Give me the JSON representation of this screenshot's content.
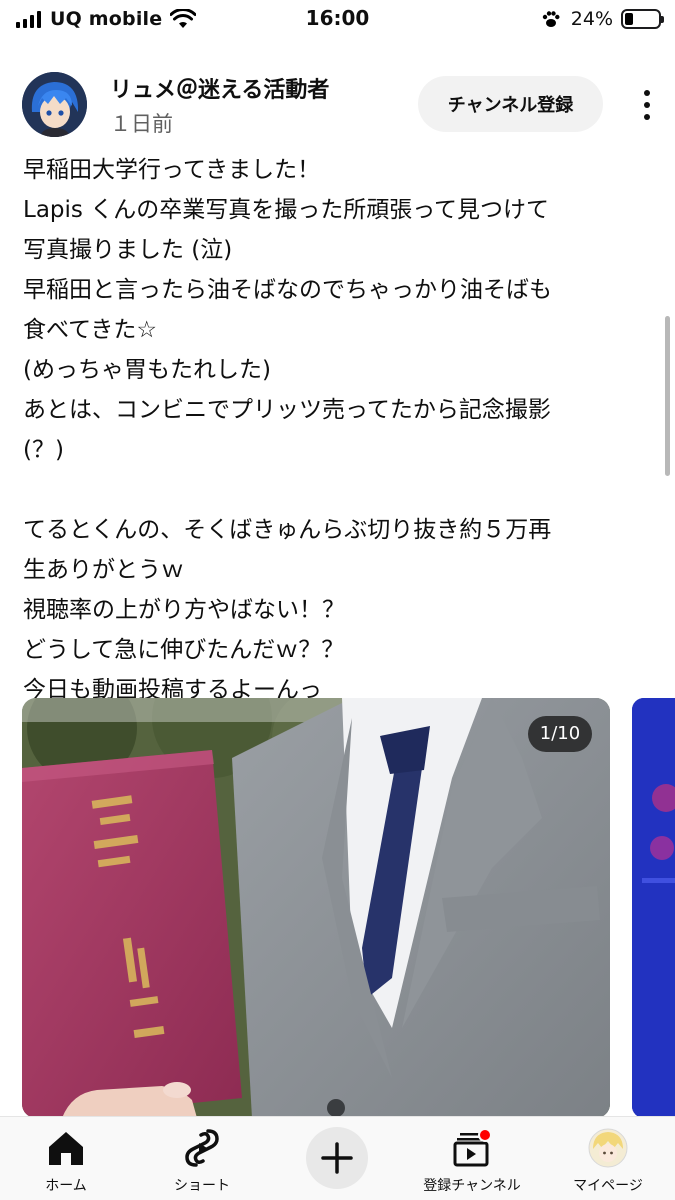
{
  "status_bar": {
    "carrier": "UQ mobile",
    "time": "16:00",
    "battery_percent": "24%",
    "battery_level": 0.24,
    "icons": [
      "signal-icon",
      "wifi-icon",
      "paw-icon",
      "battery-icon"
    ]
  },
  "post": {
    "channel_name": "リュメ＠迷える活動者",
    "time_ago": "１日前",
    "subscribe_label": "チャンネル登録",
    "more_icon": "more-vertical-icon",
    "body_lines": [
      "早稲田大学行ってきました！",
      "Lapis くんの卒業写真を撮った所頑張って見つけて",
      "写真撮りました (泣)",
      "早稲田と言ったら油そばなのでちゃっかり油そばも",
      "食べてきた☆",
      "(めっちゃ胃もたれした)",
      "あとは、コンビニでプリッツ売ってたから記念撮影",
      "(？)",
      "",
      "てるとくんの、そくばきゅんらぶ切り抜き約５万再",
      "生ありがとうｗ",
      "視聴率の上がり方やばない！？",
      "どうして急に伸びたんだｗ？？",
      "今日も動画投稿するよーんっ"
    ]
  },
  "carousel": {
    "counter": "1/10",
    "current": 1,
    "total": 10
  },
  "bottom_nav": {
    "items": [
      {
        "label": "ホーム",
        "icon": "home-icon",
        "active": true
      },
      {
        "label": "ショート",
        "icon": "shorts-icon",
        "active": false
      },
      {
        "label": "",
        "icon": "create-plus-icon",
        "active": false
      },
      {
        "label": "登録チャンネル",
        "icon": "subscriptions-icon",
        "active": false
      },
      {
        "label": "マイページ",
        "icon": "profile-avatar-icon",
        "active": false
      }
    ],
    "accent_color": "#ff0000"
  }
}
